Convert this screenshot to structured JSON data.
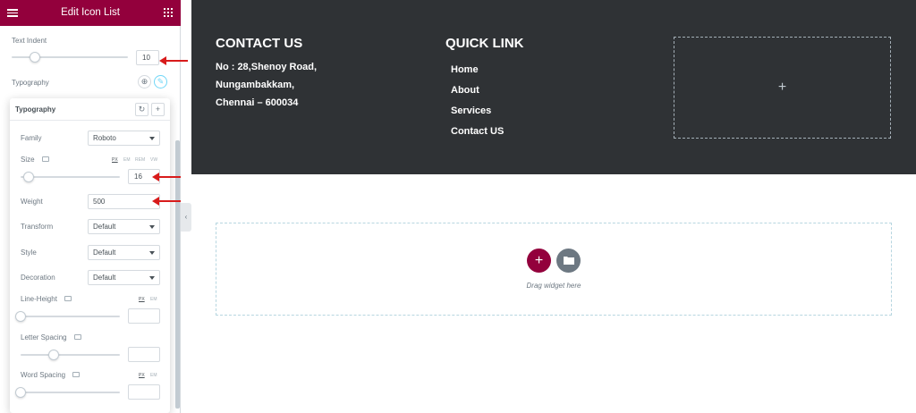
{
  "panel": {
    "title": "Edit Icon List",
    "text_indent": {
      "label": "Text Indent",
      "value": "10"
    },
    "typography_label": "Typography"
  },
  "typography": {
    "title": "Typography",
    "family": {
      "label": "Family",
      "value": "Roboto"
    },
    "size": {
      "label": "Size",
      "value": "16",
      "units": [
        "PX",
        "EM",
        "REM",
        "VW"
      ],
      "active_unit": "PX"
    },
    "weight": {
      "label": "Weight",
      "value": "500"
    },
    "transform": {
      "label": "Transform",
      "value": "Default"
    },
    "style": {
      "label": "Style",
      "value": "Default"
    },
    "decoration": {
      "label": "Decoration",
      "value": "Default"
    },
    "line_height": {
      "label": "Line-Height",
      "units": [
        "PX",
        "EM"
      ]
    },
    "letter_spacing": {
      "label": "Letter Spacing"
    },
    "word_spacing": {
      "label": "Word Spacing",
      "units": [
        "PX",
        "EM"
      ]
    }
  },
  "footer": {
    "contact_title": "CONTACT US",
    "address": [
      "No : 28,Shenoy Road,",
      "Nungambakkam,",
      "Chennai – 600034"
    ],
    "quick_title": "QUICK LINK",
    "links": [
      "Home",
      "About",
      "Services",
      "Contact US"
    ]
  },
  "dropzone": {
    "hint": "Drag widget here"
  },
  "colors": {
    "brand": "#93003c",
    "dark": "#2f3235",
    "arrow": "#d81b1b"
  }
}
